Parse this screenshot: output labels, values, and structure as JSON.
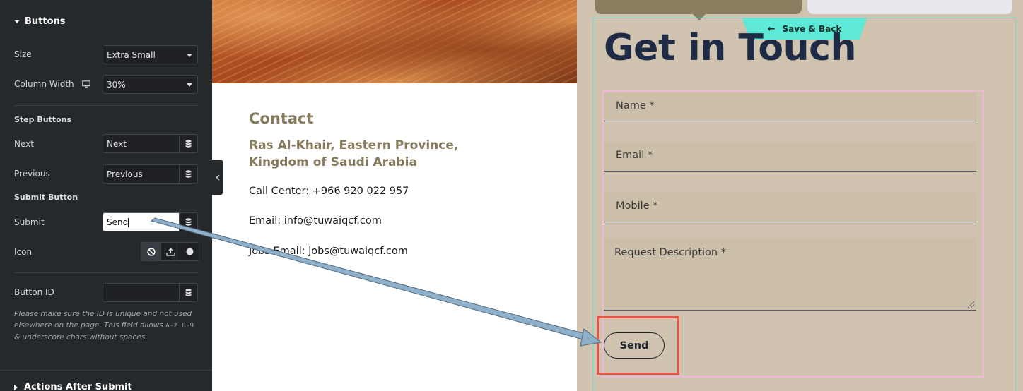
{
  "panel": {
    "section_buttons": "Buttons",
    "size_label": "Size",
    "size_value": "Extra Small",
    "column_width_label": "Column Width",
    "column_width_value": "30%",
    "step_buttons_label": "Step Buttons",
    "next_label": "Next",
    "next_value": "Next",
    "previous_label": "Previous",
    "previous_value": "Previous",
    "submit_button_label": "Submit Button",
    "submit_label": "Submit",
    "submit_value": "Send",
    "icon_label": "Icon",
    "button_id_label": "Button ID",
    "button_id_value": "",
    "help_text_1": "Please make sure the ID is unique and not used elsewhere on the page. This field allows ",
    "help_code": "A-z 0-9",
    "help_text_2": " & underscore chars without spaces.",
    "section_actions": "Actions After Submit",
    "icons": [
      "monitor-icon",
      "database-icon",
      "ban-icon",
      "upload-icon",
      "circle-icon",
      "chevron-left-icon"
    ]
  },
  "contact": {
    "title": "Contact",
    "address_line1": "Ras Al-Khair, Eastern Province,",
    "address_line2": "Kingdom of Saudi Arabia",
    "call_center": "Call Center: +966 920 022 957",
    "email": "Email: info@tuwaiqcf.com",
    "jobs_email": "Jobs Email: jobs@tuwaiqcf.com"
  },
  "form": {
    "save_back": "Save & Back",
    "title": "Get in Touch",
    "name_placeholder": "Name *",
    "email_placeholder": "Email *",
    "mobile_placeholder": "Mobile *",
    "description_placeholder": "Request Description *",
    "submit": "Send"
  },
  "colors": {
    "panel_bg": "#26292c",
    "form_bg": "#d0c4b0",
    "accent_teal": "#5ee8d6",
    "highlight_red": "#e8564a",
    "heading_dark": "#1f2a44",
    "contact_olive": "#857a5b",
    "arrow": "#8fb0c8"
  }
}
